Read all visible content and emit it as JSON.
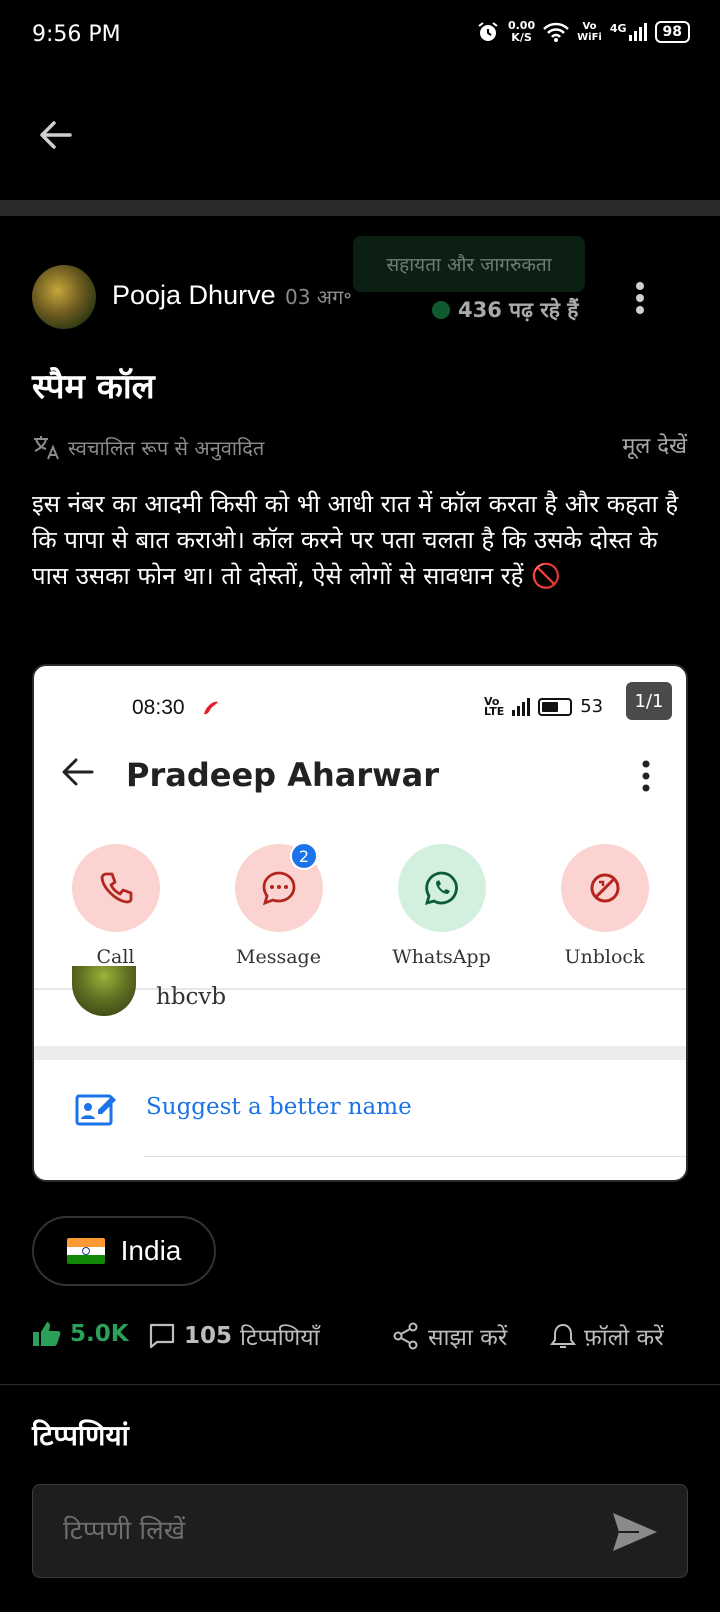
{
  "status_bar": {
    "time": "9:56 PM",
    "speed_value": "0.00",
    "speed_unit": "K/S",
    "network_vo": "Vo",
    "network_wifi": "WiFi",
    "network_type": "4G",
    "battery": "98",
    "icons": [
      "alarm-icon",
      "wifi-icon",
      "signal-icon",
      "battery-icon"
    ]
  },
  "header": {
    "back_icon": "arrow-left-icon"
  },
  "post": {
    "author": "Pooja Dhurve",
    "date": "03 अग॰",
    "category": "सहायता और जागरुकता",
    "reading_count": "436 पढ़ रहे हैं",
    "title": "स्पैम कॉल",
    "auto_translated": "स्वचालित रूप से अनुवादित",
    "view_original": "मूल देखें",
    "body": "इस नंबर का आदमी किसी को भी आधी रात में कॉल करता है और कहता है कि पापा से बात कराओ। कॉल करने पर पता चलता है कि उसके दोस्त के पास उसका फोन था। तो दोस्तों, ऐसे लोगों से सावधान रहें 🚫"
  },
  "screenshot": {
    "time": "08:30",
    "battery": "53",
    "page_indicator": "1/1",
    "contact_name": "Pradeep Aharwar",
    "actions": [
      {
        "label": "Call",
        "icon": "phone-icon"
      },
      {
        "label": "Message",
        "icon": "message-icon",
        "badge": "2"
      },
      {
        "label": "WhatsApp",
        "icon": "whatsapp-icon"
      },
      {
        "label": "Unblock",
        "icon": "unblock-icon"
      }
    ],
    "list_name": "hbcvb",
    "suggest": "Suggest a better name"
  },
  "country": "India",
  "stats": {
    "likes": "5.0K",
    "comments_count": "105",
    "comments_label": "टिप्पणियाँ",
    "share": "साझा करें",
    "follow": "फ़ॉलो करें"
  },
  "comments_heading": "टिप्पणियां",
  "comment_placeholder": "टिप्पणी लिखें",
  "colors": {
    "accent_green": "#2aa05a",
    "link_blue": "#1a73e8",
    "background": "#000000"
  }
}
